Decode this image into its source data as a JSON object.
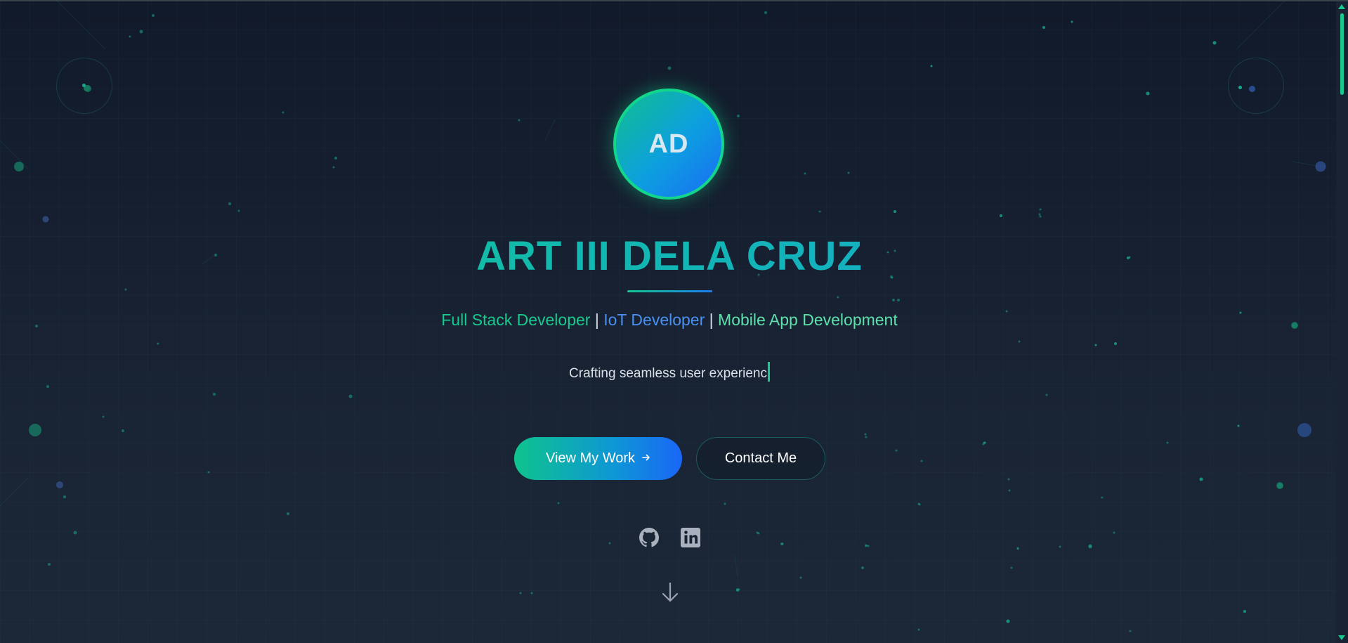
{
  "hero": {
    "avatar_initials": "AD",
    "name": "ART III DELA CRUZ",
    "roles": [
      {
        "label": "Full Stack Developer",
        "color": "#19c98d"
      },
      {
        "label": "IoT Developer",
        "color": "#4a90f0"
      },
      {
        "label": "Mobile App Development",
        "color": "#5ee0ac"
      }
    ],
    "role_separator": "|",
    "tagline": "Crafting seamless user experienc"
  },
  "actions": {
    "primary_label": "View My Work",
    "primary_icon": "arrow-right-icon",
    "secondary_label": "Contact Me"
  },
  "social": [
    {
      "name": "github-icon"
    },
    {
      "name": "linkedin-icon"
    }
  ],
  "scroll_indicator": {
    "icon": "arrow-down-icon"
  },
  "colors": {
    "accent_green": "#12d68b",
    "accent_blue": "#1a6cf5",
    "background": "#151f2e"
  }
}
